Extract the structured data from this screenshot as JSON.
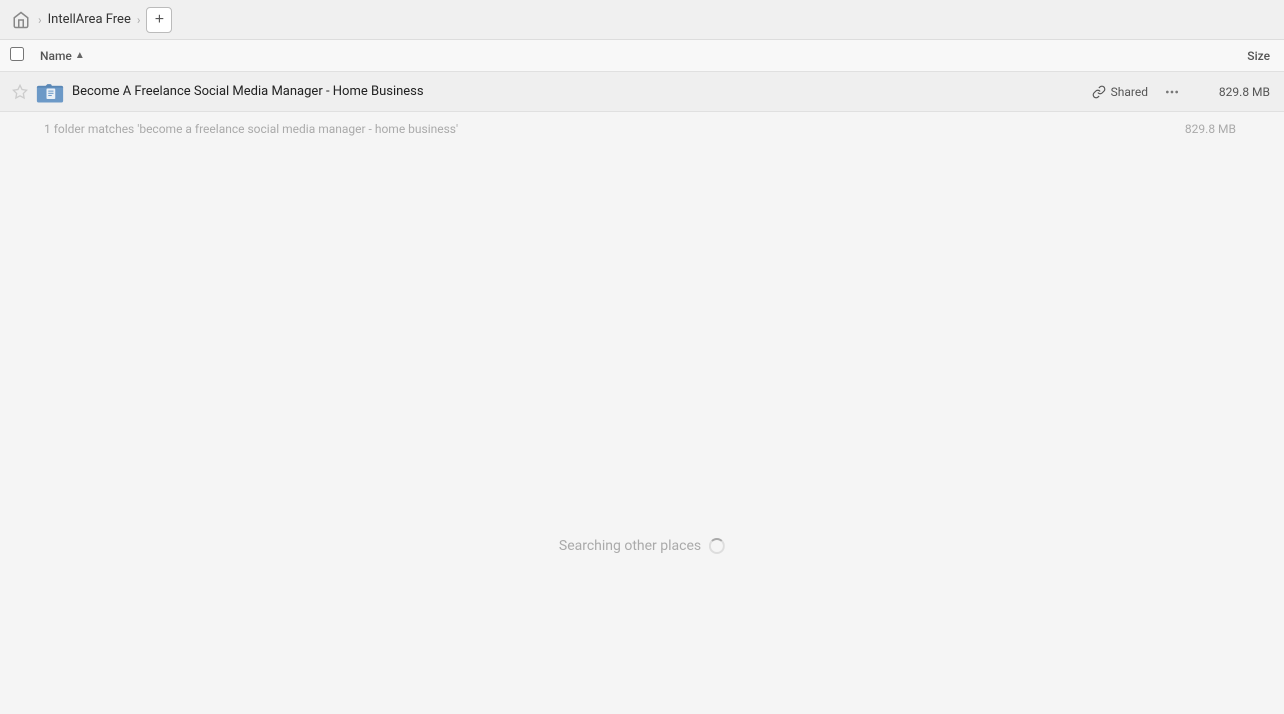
{
  "topbar": {
    "home_label": "Home",
    "breadcrumb_label": "IntellArea Free",
    "add_button_label": "+"
  },
  "columns": {
    "name_label": "Name",
    "size_label": "Size",
    "sort_indicator": "▲"
  },
  "file_row": {
    "name": "Become A Freelance Social Media Manager - Home Business",
    "shared_label": "Shared",
    "size": "829.8 MB"
  },
  "match_info": {
    "text": "1 folder matches 'become a freelance social media manager - home business'",
    "size": "829.8 MB"
  },
  "searching": {
    "label": "Searching other places"
  }
}
